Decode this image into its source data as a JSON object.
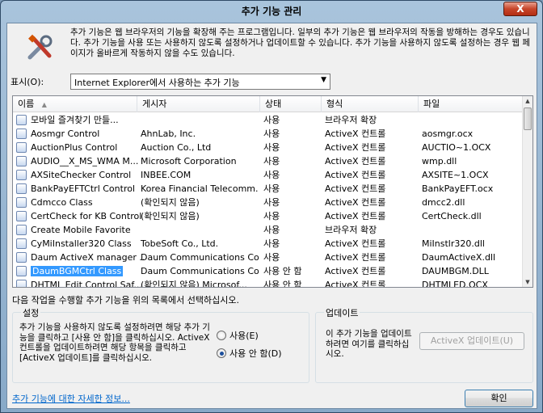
{
  "window": {
    "title": "추가 기능 관리",
    "close_label": "X"
  },
  "header": {
    "icon": "addon-tools-icon",
    "description": "추가 기능은 웹 브라우저의 기능을 확장해 주는 프로그램입니다. 일부의 추가 기능은 웹 브라우저의 작동을 방해하는 경우도 있습니다. 추가 기능을 사용 또는 사용하지 않도록 설정하거나 업데이트할 수 있습니다. 추가 기능을 사용하지 않도록 설정하는 경우 웹 페이지가 올바르게 작동하지 않을 수도 있습니다."
  },
  "show": {
    "label": "표시(O):",
    "selected": "Internet Explorer에서 사용하는 추가 기능"
  },
  "table": {
    "columns": [
      "이름",
      "게시자",
      "상태",
      "형식",
      "파일"
    ],
    "rows": [
      {
        "name": "모바일 즐겨찾기 만들...",
        "publisher": "",
        "status": "사용",
        "type": "브라우저 확장",
        "file": ""
      },
      {
        "name": "Aosmgr Control",
        "publisher": "AhnLab, Inc.",
        "status": "사용",
        "type": "ActiveX 컨트롤",
        "file": "aosmgr.ocx"
      },
      {
        "name": "AuctionPlus Control",
        "publisher": "Auction Co., Ltd",
        "status": "사용",
        "type": "ActiveX 컨트롤",
        "file": "AUCTIO~1.OCX"
      },
      {
        "name": "AUDIO__X_MS_WMA M...",
        "publisher": "Microsoft Corporation",
        "status": "사용",
        "type": "ActiveX 컨트롤",
        "file": "wmp.dll"
      },
      {
        "name": "AXSiteChecker Control",
        "publisher": "INBEE.COM",
        "status": "사용",
        "type": "ActiveX 컨트롤",
        "file": "AXSITE~1.OCX"
      },
      {
        "name": "BankPayEFTCtrl Control",
        "publisher": "Korea Financial Telecomm...",
        "status": "사용",
        "type": "ActiveX 컨트롤",
        "file": "BankPayEFT.ocx"
      },
      {
        "name": "Cdmcco Class",
        "publisher": "(확인되지 않음)",
        "status": "사용",
        "type": "ActiveX 컨트롤",
        "file": "dmcc2.dll"
      },
      {
        "name": "CertCheck for KB Control",
        "publisher": "(확인되지 않음)",
        "status": "사용",
        "type": "ActiveX 컨트롤",
        "file": "CertCheck.dll"
      },
      {
        "name": "Create Mobile Favorite",
        "publisher": "",
        "status": "사용",
        "type": "브라우저 확장",
        "file": ""
      },
      {
        "name": "CyMiInstaller320 Class",
        "publisher": "TobeSoft Co., Ltd.",
        "status": "사용",
        "type": "ActiveX 컨트롤",
        "file": "MiInstlr320.dll"
      },
      {
        "name": "Daum ActiveX manager ...",
        "publisher": "Daum Communications Corp.",
        "status": "사용",
        "type": "ActiveX 컨트롤",
        "file": "DaumActiveX.dll"
      },
      {
        "name": "DaumBGMCtrl Class",
        "publisher": "Daum Communications Corp.",
        "status": "사용 안 함",
        "type": "ActiveX 컨트롤",
        "file": "DAUMBGM.DLL",
        "selected": true
      },
      {
        "name": "DHTML Edit Control Saf...",
        "publisher": "(확인되지 않음) Microsof...",
        "status": "사용 안 함",
        "type": "ActiveX 컨트롤",
        "file": "DHTMLED.OCX"
      }
    ]
  },
  "hint": "다음 작업을 수행할 추가 기능을 위의 목록에서 선택하십시오.",
  "settings": {
    "title": "설정",
    "text": "추가 기능을 사용하지 않도록 설정하려면 해당 추가 기능을 클릭하고 [사용 안 함]을 클릭하십시오. ActiveX 컨트롤을 업데이트하려면 해당 항목을 클릭하고 [ActiveX 업데이트]를 클릭하십시오.",
    "enable": "사용(E)",
    "disable": "사용 안 함(D)"
  },
  "update": {
    "title": "업데이트",
    "text": "이 추가 기능을 업데이트하려면 여기를 클릭하십시오.",
    "button": "ActiveX 업데이트(U)"
  },
  "footer": {
    "link": "추가 기능에 대한 자세한 정보...",
    "ok": "확인"
  }
}
